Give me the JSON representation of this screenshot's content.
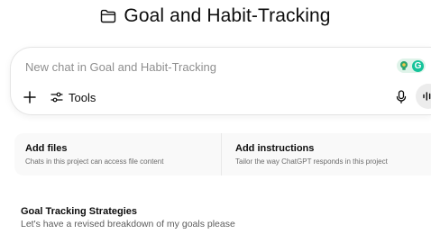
{
  "project": {
    "title": "Goal and Habit-Tracking",
    "icon": "folder-icon"
  },
  "composer": {
    "placeholder": "New chat in Goal and Habit-Tracking",
    "value": "",
    "tools_label": "Tools",
    "plus_icon": "plus-icon",
    "tools_icon": "sliders-icon",
    "mic_icon": "microphone-icon",
    "voice_icon": "voice-waveform-icon",
    "grammarly_logo_letter": "G"
  },
  "cards": [
    {
      "title": "Add files",
      "description": "Chats in this project can access file content"
    },
    {
      "title": "Add instructions",
      "description": "Tailor the way ChatGPT responds in this project"
    }
  ],
  "chats": [
    {
      "title": "Goal Tracking Strategies",
      "snippet": "Let's have a revised breakdown of my goals please"
    }
  ],
  "colors": {
    "grammarly_green": "#15c39a",
    "grammarly_bg": "#dff3e9",
    "bulb_green": "#2aa36b",
    "bulb_yellow": "#f2c94c",
    "card_bg": "#f9f9f9",
    "voice_btn_bg": "#ececec"
  }
}
